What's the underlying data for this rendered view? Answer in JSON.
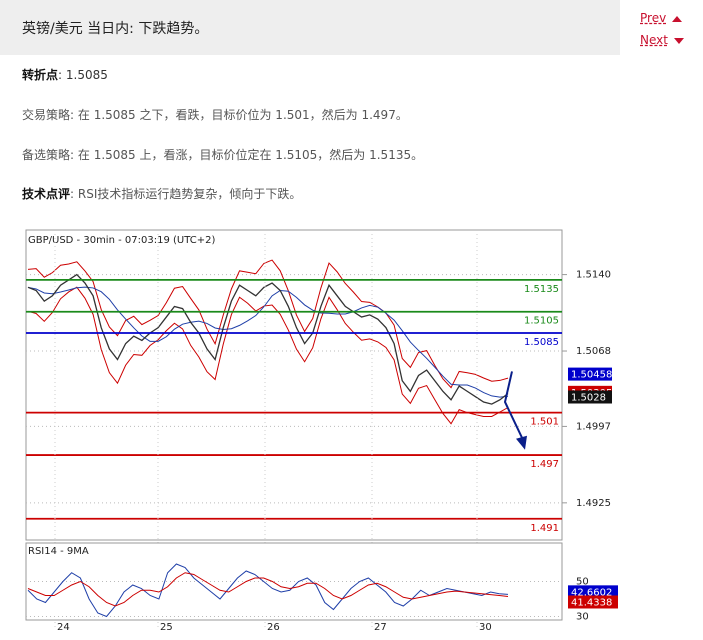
{
  "header": {
    "title": "英镑/美元 当日内: 下跌趋势。",
    "prev_label": "Prev",
    "next_label": "Next"
  },
  "analysis": {
    "pivot_label": "转折点",
    "pivot_value": ": 1.5085",
    "strategy_label": "交易策略",
    "strategy_text": ": 在 1.5085 之下，看跌，目标价位为 1.501，然后为 1.497。",
    "alt_label": "备选策略",
    "alt_text": ": 在 1.5085 上，看涨，目标价位定在 1.5105，然后为 1.5135。",
    "comment_label": "技术点评",
    "comment_text": ": RSI技术指标运行趋势复杂，倾向于下跌。"
  },
  "colors": {
    "accent": "#c8102e",
    "green_level": "#1a8a1a",
    "blue_level": "#0000cc",
    "red_level": "#cc0000",
    "price": "#333333",
    "ma": "#1f3fa8",
    "bands": "#cc0000",
    "arrow": "#0a1f8a"
  },
  "chart_data": [
    {
      "type": "line",
      "title": "GBP/USD - 30min - 07:03:19 (UTC+2)",
      "ylim": [
        1.489,
        1.5182
      ],
      "y_ticks": [
        "1.5140",
        "1.5068",
        "1.4997",
        "1.4925"
      ],
      "x_ticks": [
        "24",
        "25",
        "26",
        "27",
        "30"
      ],
      "levels": [
        {
          "value": 1.5135,
          "label": "1.5135",
          "color": "green"
        },
        {
          "value": 1.5105,
          "label": "1.5105",
          "color": "green"
        },
        {
          "value": 1.5085,
          "label": "1.5085",
          "color": "blue"
        },
        {
          "value": 1.501,
          "label": "1.501",
          "color": "red"
        },
        {
          "value": 1.497,
          "label": "1.497",
          "color": "red"
        },
        {
          "value": 1.491,
          "label": "1.491",
          "color": "red"
        }
      ],
      "price_tags": [
        {
          "value": 1.50458,
          "label": "1.50458",
          "color": "blue"
        },
        {
          "value": 1.50305,
          "label": "1.50305",
          "color": "red"
        },
        {
          "value": 1.5028,
          "label": "1.5028",
          "color": "black"
        }
      ],
      "series": [
        {
          "values": [
            1.5128,
            1.5125,
            1.5115,
            1.512,
            1.513,
            1.5135,
            1.514,
            1.5132,
            1.512,
            1.509,
            1.507,
            1.506,
            1.5075,
            1.5082,
            1.5078,
            1.5085,
            1.509,
            1.51,
            1.511,
            1.5108,
            1.5095,
            1.5085,
            1.507,
            1.506,
            1.509,
            1.5115,
            1.513,
            1.5125,
            1.512,
            1.5128,
            1.5132,
            1.5125,
            1.511,
            1.509,
            1.5075,
            1.5085,
            1.511,
            1.513,
            1.512,
            1.511,
            1.5105,
            1.51,
            1.5102,
            1.5098,
            1.509,
            1.5075,
            1.504,
            1.503,
            1.5045,
            1.505,
            1.504,
            1.503,
            1.5022,
            1.5035,
            1.503,
            1.5025,
            1.502,
            1.5018,
            1.5022,
            1.5028
          ]
        },
        {
          "values": [
            1.509,
            1.508,
            1.507,
            1.505,
            1.504,
            1.5035,
            1.503
          ]
        }
      ],
      "arrow": {
        "from": 1.5045,
        "to": 1.4975
      }
    },
    {
      "type": "line",
      "title": "RSI14 - 9MA",
      "ylim": [
        28,
        72
      ],
      "y_ticks": [
        "50",
        "30"
      ],
      "price_tags": [
        {
          "value": 42.6602,
          "label": "42.6602",
          "color": "blue"
        },
        {
          "value": 41.4338,
          "label": "41.4338",
          "color": "red"
        }
      ],
      "series": [
        {
          "values": [
            45,
            40,
            38,
            44,
            50,
            55,
            52,
            40,
            32,
            30,
            36,
            44,
            48,
            46,
            42,
            40,
            55,
            60,
            58,
            52,
            48,
            44,
            40,
            46,
            52,
            56,
            54,
            50,
            46,
            44,
            45,
            50,
            52,
            48,
            38,
            34,
            40,
            46,
            50,
            52,
            48,
            44,
            38,
            36,
            40,
            45,
            42,
            44,
            46,
            45,
            44,
            43,
            42,
            44,
            43,
            42.66
          ]
        },
        {
          "values": [
            46,
            44,
            42,
            42,
            45,
            48,
            50,
            47,
            42,
            38,
            36,
            38,
            42,
            45,
            45,
            44,
            47,
            52,
            55,
            54,
            51,
            48,
            45,
            44,
            47,
            50,
            52,
            52,
            50,
            47,
            46,
            47,
            49,
            49,
            46,
            42,
            40,
            42,
            45,
            48,
            49,
            47,
            44,
            41,
            40,
            41,
            42,
            43,
            44,
            44.5,
            44,
            43.5,
            43,
            42.5,
            42,
            41.43
          ]
        }
      ]
    }
  ]
}
